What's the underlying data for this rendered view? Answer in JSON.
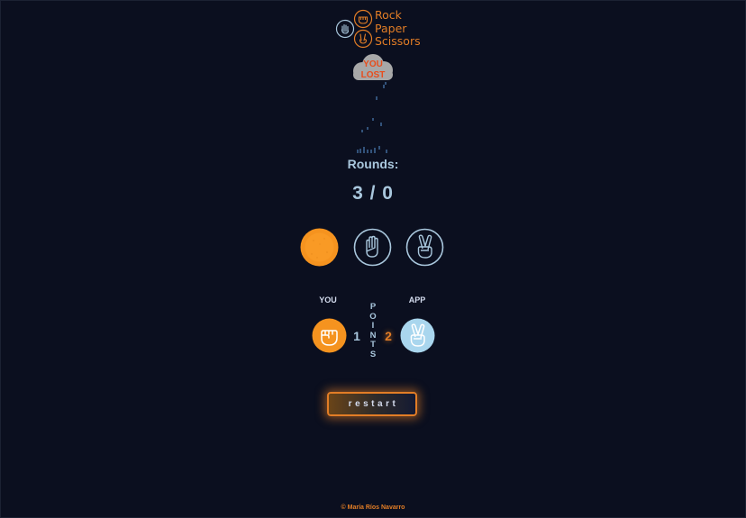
{
  "logo": {
    "line1": "Rock",
    "line2": "Paper",
    "line3": "Scissors"
  },
  "result": {
    "line1": "YOU",
    "line2": "LOST"
  },
  "rounds": {
    "label": "Rounds:",
    "value": "3 / 0"
  },
  "choices": [
    {
      "name": "rock",
      "state": "selected"
    },
    {
      "name": "paper",
      "state": "idle"
    },
    {
      "name": "scissors",
      "state": "idle"
    }
  ],
  "scoreboard": {
    "you_label": "YOU",
    "app_label": "APP",
    "you_points": "1",
    "app_points": "2",
    "you_hand": "rock",
    "app_hand": "scissors",
    "points_word": [
      "P",
      "O",
      "I",
      "N",
      "T",
      "S"
    ]
  },
  "restart_label": "restart",
  "footer": "© María Ríos Navarro",
  "colors": {
    "background": "#0b0f1f",
    "accent": "#e27d26",
    "light": "#a9c7dd",
    "lost": "#e84d1c"
  }
}
